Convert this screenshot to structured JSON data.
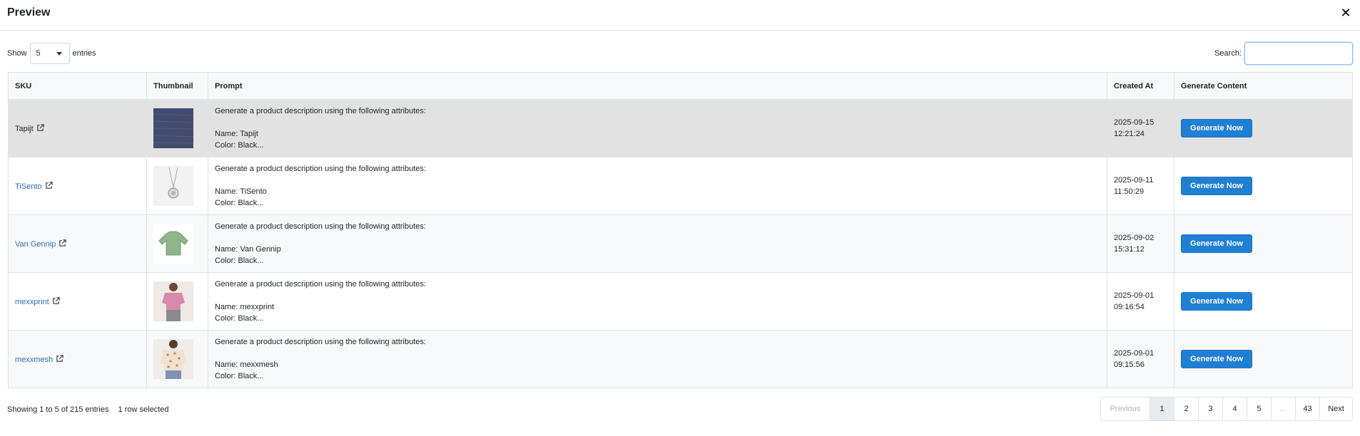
{
  "modal": {
    "title": "Preview",
    "close_glyph": "✕"
  },
  "length": {
    "show_label": "Show",
    "value": "5",
    "entries_label": "entries"
  },
  "search": {
    "label": "Search:",
    "value": "",
    "placeholder": ""
  },
  "table": {
    "columns": [
      "SKU",
      "Thumbnail",
      "Prompt",
      "Created At",
      "Generate Content"
    ],
    "rows": [
      {
        "sku": "Tapijt",
        "thumbnail": "rug-swatch-thumbnail",
        "prompt_line1": "Generate a product description using the following attributes:",
        "prompt_name": "Name: Tapijt",
        "prompt_color": "Color: Black...",
        "created_date": "2025-09-15",
        "created_time": "12:21:24",
        "button": "Generate Now"
      },
      {
        "sku": "TiSento",
        "thumbnail": "necklace-thumbnail",
        "prompt_line1": "Generate a product description using the following attributes:",
        "prompt_name": "Name: TiSento",
        "prompt_color": "Color: Black...",
        "created_date": "2025-09-11",
        "created_time": "11:50:29",
        "button": "Generate Now"
      },
      {
        "sku": "Van Gennip",
        "thumbnail": "green-sweater-thumbnail",
        "prompt_line1": "Generate a product description using the following attributes:",
        "prompt_name": "Name: Van Gennip",
        "prompt_color": "Color: Black...",
        "created_date": "2025-09-02",
        "created_time": "15:31:12",
        "button": "Generate Now"
      },
      {
        "sku": "mexxprint",
        "thumbnail": "pink-top-thumbnail",
        "prompt_line1": "Generate a product description using the following attributes:",
        "prompt_name": "Name: mexxprint",
        "prompt_color": "Color: Black...",
        "created_date": "2025-09-01",
        "created_time": "09:16:54",
        "button": "Generate Now"
      },
      {
        "sku": "mexxmesh",
        "thumbnail": "floral-blouse-thumbnail",
        "prompt_line1": "Generate a product description using the following attributes:",
        "prompt_name": "Name: mexxmesh",
        "prompt_color": "Color: Black...",
        "created_date": "2025-09-01",
        "created_time": "09:15:56",
        "button": "Generate Now"
      }
    ]
  },
  "footer": {
    "info": "Showing 1 to 5 of 215 entries",
    "selected": "1 row selected"
  },
  "pagination": {
    "previous": "Previous",
    "pages": [
      "1",
      "2",
      "3",
      "4",
      "5"
    ],
    "ellipsis": "…",
    "last": "43",
    "next": "Next",
    "active": "1"
  },
  "colors": {
    "primary_button": "#1f7fd4",
    "link": "#2a6cb3",
    "selected_row": "#e2e2e2"
  }
}
